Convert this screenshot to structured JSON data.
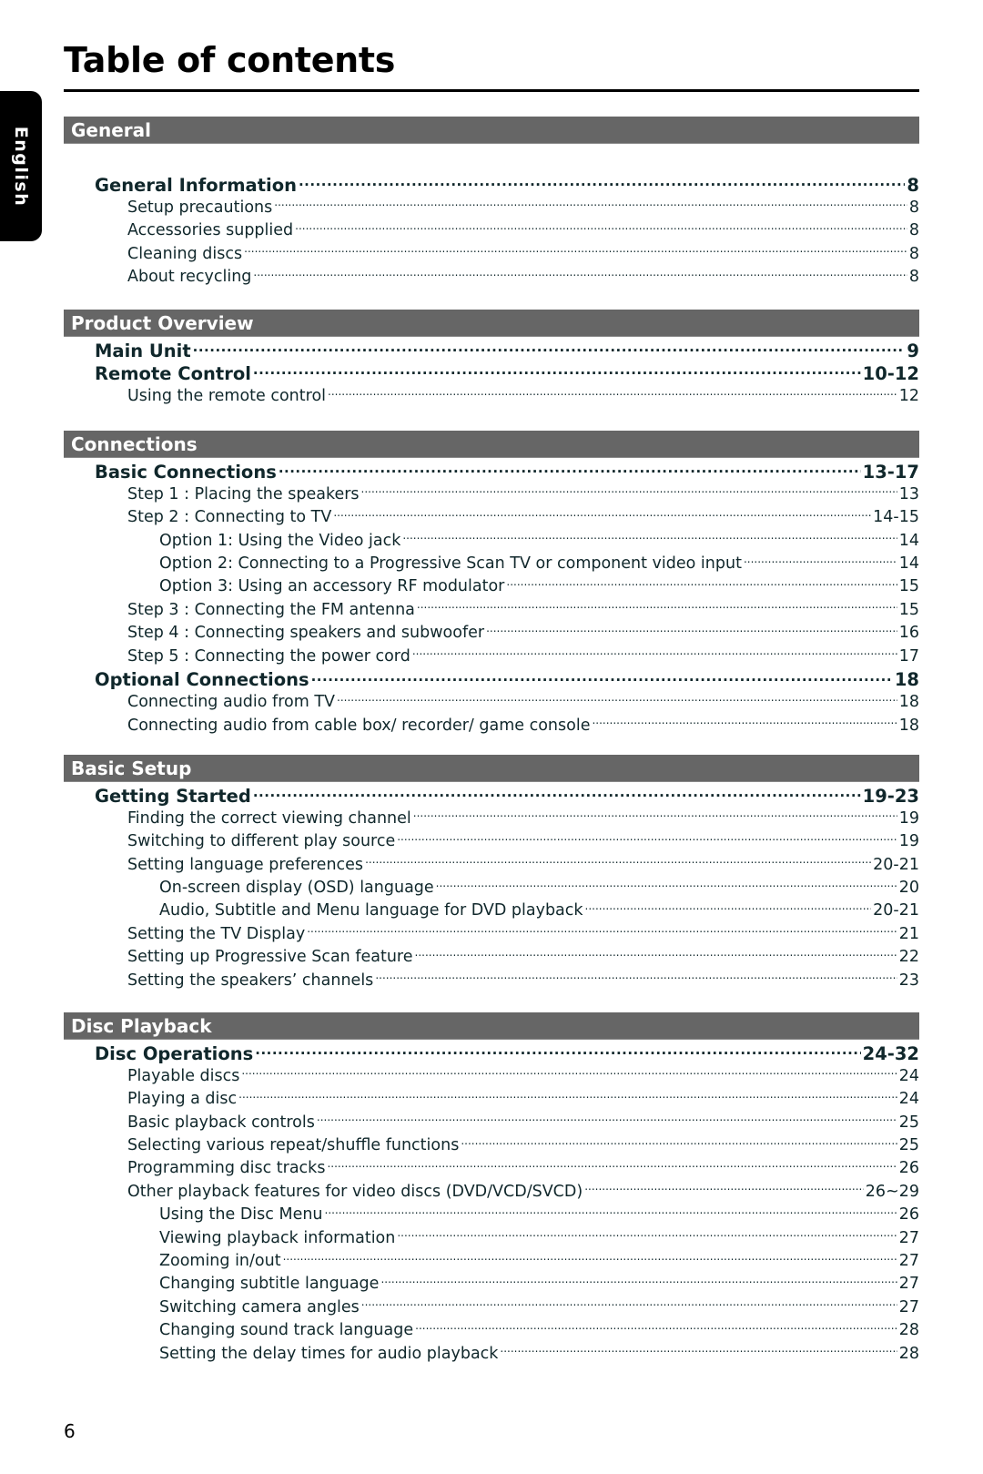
{
  "page": {
    "title": "Table of contents",
    "language_tab": "English",
    "page_number": "6"
  },
  "sections": [
    {
      "heading": "General",
      "entries": [
        {
          "level": 1,
          "label": "General Information",
          "page": "8"
        },
        {
          "level": 2,
          "label": "Setup precautions",
          "page": "8"
        },
        {
          "level": 2,
          "label": "Accessories supplied",
          "page": "8"
        },
        {
          "level": 2,
          "label": "Cleaning discs",
          "page": "8"
        },
        {
          "level": 2,
          "label": "About recycling",
          "page": "8"
        }
      ]
    },
    {
      "heading": "Product Overview",
      "entries": [
        {
          "level": 1,
          "label": "Main Unit",
          "page": "9"
        },
        {
          "level": 1,
          "label": "Remote Control",
          "page": "10-12"
        },
        {
          "level": 2,
          "label": "Using the remote control",
          "page": "12"
        }
      ]
    },
    {
      "heading": "Connections",
      "entries": [
        {
          "level": 1,
          "label": "Basic Connections",
          "page": "13-17"
        },
        {
          "level": 2,
          "label": "Step 1 : Placing the speakers",
          "page": "13"
        },
        {
          "level": 2,
          "label": "Step 2 : Connecting to TV",
          "page": "14-15"
        },
        {
          "level": 3,
          "label": "Option 1: Using the Video jack",
          "page": "14"
        },
        {
          "level": 3,
          "label": "Option 2: Connecting to a Progressive Scan TV or component video input",
          "page": "14"
        },
        {
          "level": 3,
          "label": "Option 3: Using an accessory RF modulator",
          "page": "15"
        },
        {
          "level": 2,
          "label": "Step 3 : Connecting the FM antenna",
          "page": "15"
        },
        {
          "level": 2,
          "label": "Step 4 : Connecting speakers and subwoofer",
          "page": "16"
        },
        {
          "level": 2,
          "label": "Step 5 : Connecting the power cord",
          "page": "17"
        },
        {
          "level": 1,
          "label": "Optional Connections",
          "page": "18"
        },
        {
          "level": 2,
          "label": "Connecting audio from TV",
          "page": "18"
        },
        {
          "level": 2,
          "label": "Connecting audio from cable box/ recorder/ game console",
          "page": "18"
        }
      ]
    },
    {
      "heading": "Basic Setup",
      "entries": [
        {
          "level": 1,
          "label": "Getting Started",
          "page": "19-23"
        },
        {
          "level": 2,
          "label": "Finding the correct viewing channel",
          "page": "19"
        },
        {
          "level": 2,
          "label": "Switching to different play source",
          "page": "19"
        },
        {
          "level": 2,
          "label": "Setting language preferences",
          "page": "20-21"
        },
        {
          "level": 3,
          "label": "On-screen display (OSD) language",
          "page": "20"
        },
        {
          "level": 3,
          "label": "Audio, Subtitle and Menu language for DVD playback",
          "page": "20-21"
        },
        {
          "level": 2,
          "label": "Setting the TV Display",
          "page": "21"
        },
        {
          "level": 2,
          "label": "Setting up Progressive Scan feature",
          "page": "22"
        },
        {
          "level": 2,
          "label": "Setting the speakers’ channels",
          "page": "23"
        }
      ]
    },
    {
      "heading": "Disc Playback",
      "entries": [
        {
          "level": 1,
          "label": "Disc Operations",
          "page": "24-32"
        },
        {
          "level": 2,
          "label": "Playable discs",
          "page": "24"
        },
        {
          "level": 2,
          "label": "Playing a disc",
          "page": "24"
        },
        {
          "level": 2,
          "label": "Basic playback controls",
          "page": "25"
        },
        {
          "level": 2,
          "label": "Selecting various repeat/shuffle functions",
          "page": "25"
        },
        {
          "level": 2,
          "label": "Programming disc tracks",
          "page": "26"
        },
        {
          "level": 2,
          "label": "Other playback features for video discs (DVD/VCD/SVCD)",
          "page": "26~29"
        },
        {
          "level": 3,
          "label": "Using the Disc Menu",
          "page": "26"
        },
        {
          "level": 3,
          "label": "Viewing playback information",
          "page": "27"
        },
        {
          "level": 3,
          "label": "Zooming in/out",
          "page": "27"
        },
        {
          "level": 3,
          "label": "Changing subtitle language",
          "page": "27"
        },
        {
          "level": 3,
          "label": "Switching camera angles",
          "page": "27"
        },
        {
          "level": 3,
          "label": "Changing sound track language",
          "page": "28"
        },
        {
          "level": 3,
          "label": "Setting the delay times for audio playback",
          "page": "28"
        }
      ]
    }
  ]
}
